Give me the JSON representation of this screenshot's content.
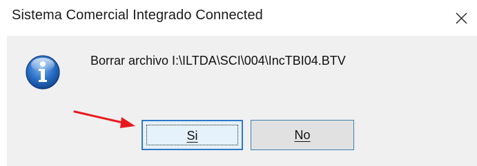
{
  "window": {
    "title": "Sistema Comercial Integrado Connected"
  },
  "dialog": {
    "icon": "info-icon",
    "message": "Borrar archivo I:\\ILTDA\\SCI\\004\\IncTBI04.BTV"
  },
  "buttons": {
    "yes_label": "Si",
    "no_label": "No",
    "default_button": "Si"
  },
  "annotation": {
    "arrow_color": "#e8191e",
    "points_to": "Si"
  },
  "colors": {
    "accent": "#2f78c8",
    "dialog_body": "#f0f0f0",
    "info_icon_blue": "#1f5fb3"
  }
}
